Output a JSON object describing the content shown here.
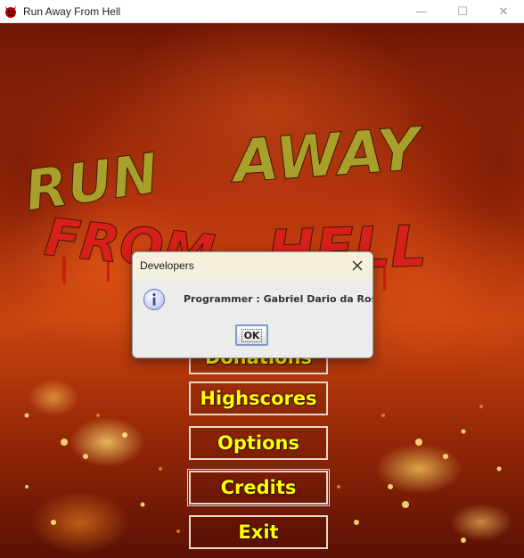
{
  "window": {
    "title": "Run Away From Hell",
    "minimize_glyph": "—",
    "maximize_glyph": "☐",
    "close_glyph": "✕",
    "app_icon": "devil-icon"
  },
  "logo": {
    "line1": [
      "RUN",
      "AWAY"
    ],
    "line2": [
      "FROM",
      "HELL"
    ],
    "colors": {
      "olive": "#a8a02a",
      "red": "#d8201a"
    }
  },
  "menu": {
    "items": [
      {
        "label": "Donations"
      },
      {
        "label": "Highscores"
      },
      {
        "label": "Options"
      },
      {
        "label": "Credits"
      },
      {
        "label": "Exit"
      }
    ],
    "text_color": "#ffff00"
  },
  "dialog": {
    "title": "Developers",
    "message": "Programmer : Gabriel Dario da Rosa",
    "ok_label": "OK",
    "icon": "info-icon"
  }
}
